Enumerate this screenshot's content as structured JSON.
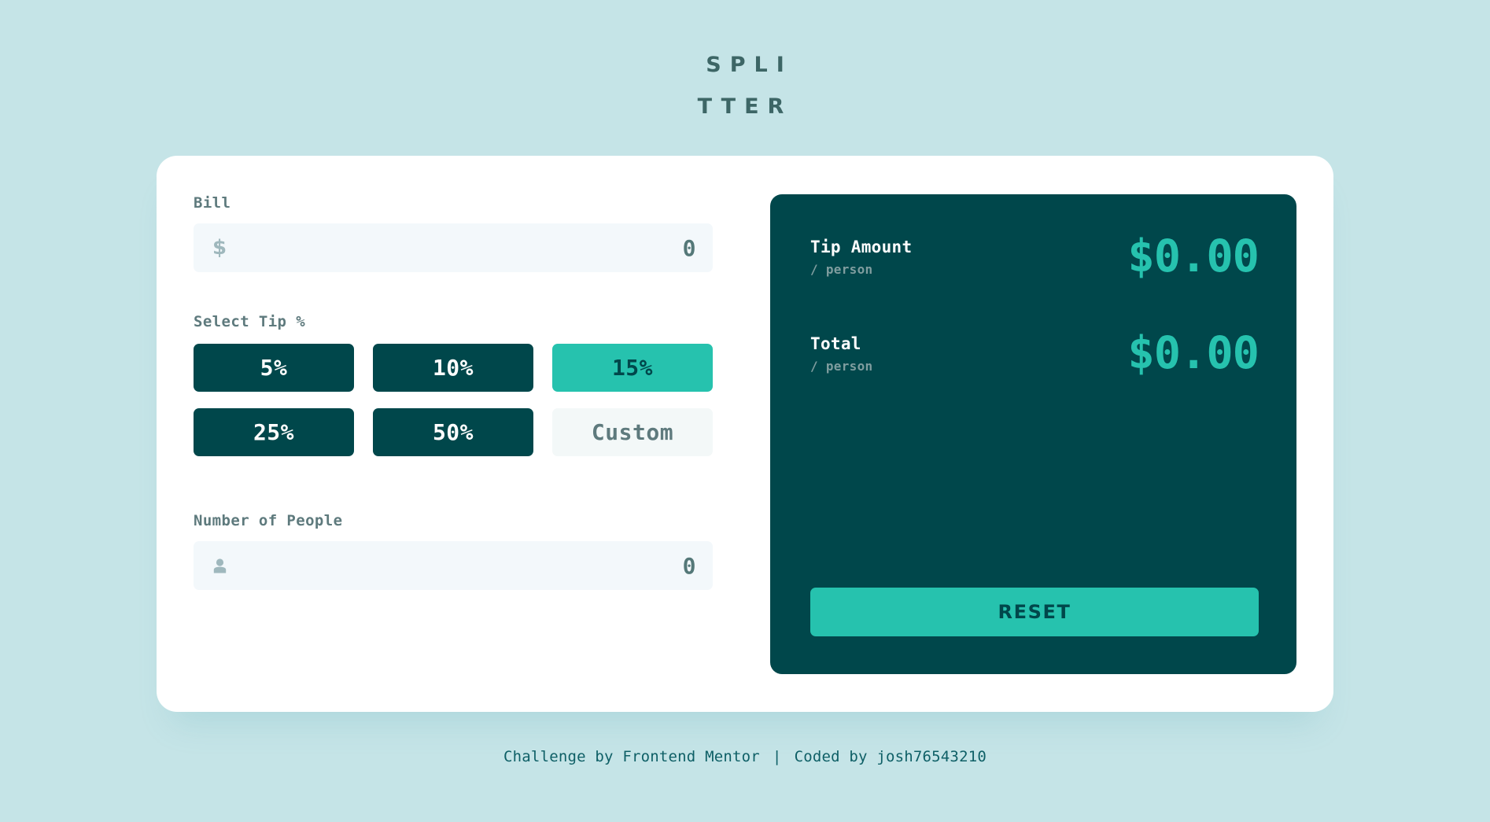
{
  "app": {
    "title_line_1": "SPLI",
    "title_line_2": "TTER"
  },
  "bill": {
    "label": "Bill",
    "icon": "dollar-icon",
    "icon_glyph": "$",
    "value": "0",
    "placeholder": "0"
  },
  "tip": {
    "label": "Select Tip %",
    "options": [
      {
        "label": "5%",
        "value": 5,
        "active": false
      },
      {
        "label": "10%",
        "value": 10,
        "active": false
      },
      {
        "label": "15%",
        "value": 15,
        "active": true
      },
      {
        "label": "25%",
        "value": 25,
        "active": false
      },
      {
        "label": "50%",
        "value": 50,
        "active": false
      }
    ],
    "custom_label": "Custom",
    "custom_placeholder": "Custom",
    "custom_value": ""
  },
  "people": {
    "label": "Number of People",
    "icon": "person-icon",
    "value": "0",
    "placeholder": "0"
  },
  "summary": {
    "tip": {
      "title": "Tip Amount",
      "subtitle": "/ person",
      "amount": "$0.00"
    },
    "total": {
      "title": "Total",
      "subtitle": "/ person",
      "amount": "$0.00"
    },
    "reset_label": "RESET"
  },
  "footer": {
    "challenge_text": "Challenge by Frontend Mentor",
    "divider": "|",
    "credit_text": "Coded by josh76543210"
  },
  "colors": {
    "page_background": "#c5e4e7",
    "card_background": "#ffffff",
    "panel_background": "#00474b",
    "accent": "#26c2ae",
    "label_text": "#5e7a7d",
    "input_background": "#f3f8fb",
    "title_text": "#3d6666",
    "muted_text": "#7f9d9f"
  }
}
